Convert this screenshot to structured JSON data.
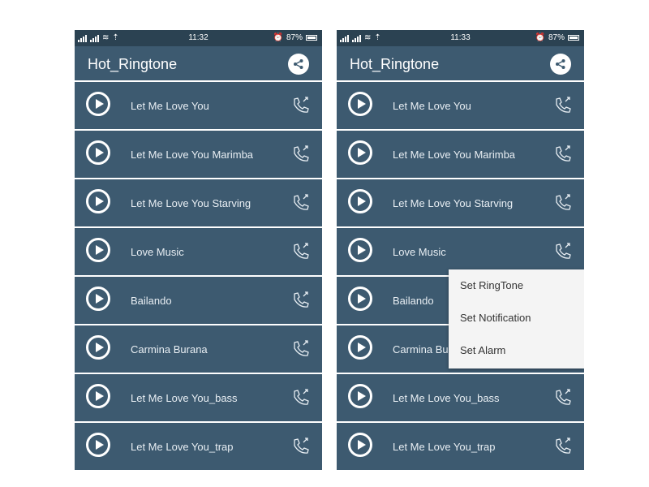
{
  "screens": [
    {
      "status": {
        "time": "11:32",
        "battery": "87%"
      },
      "app_title": "Hot_Ringtone",
      "songs": [
        "Let Me Love You",
        "Let Me Love You Marimba",
        "Let Me Love You Starving",
        "Love Music",
        "Bailando",
        "Carmina Burana",
        "Let Me Love You_bass",
        "Let Me Love You_trap"
      ]
    },
    {
      "status": {
        "time": "11:33",
        "battery": "87%"
      },
      "app_title": "Hot_Ringtone",
      "songs": [
        "Let Me Love You",
        "Let Me Love You Marimba",
        "Let Me Love You Starving",
        "Love Music",
        "Bailando",
        "Carmina Bu",
        "Let Me Love You_bass",
        "Let Me Love You_trap"
      ],
      "popup_menu": [
        "Set RingTone",
        "Set Notification",
        "Set Alarm"
      ]
    }
  ],
  "colors": {
    "status_bar": "#2b4252",
    "app_bar": "#3d5a70",
    "row": "#3d5a70",
    "popup": "#f4f4f4"
  },
  "icons": {
    "play": "play-icon",
    "ringtone": "phone-ring-icon",
    "share": "share-icon"
  }
}
